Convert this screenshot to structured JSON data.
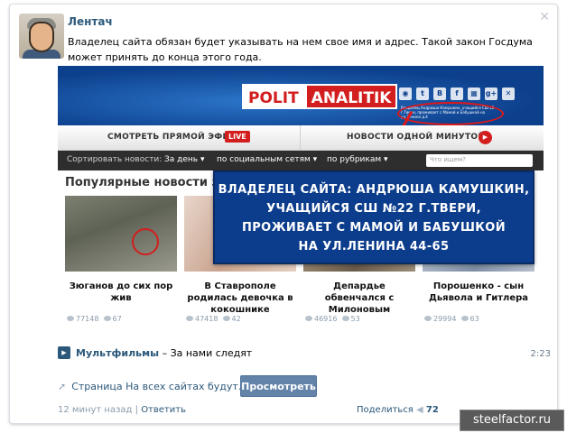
{
  "post": {
    "author": "Лентач",
    "text": "Владелец сайта обязан будет указывать на нем свое имя и адрес. Такой закон Госдума может принять до конца этого года."
  },
  "embed": {
    "logo_part1": "POLIT",
    "logo_part2": "ANALITIK",
    "socials": [
      "◉",
      "t",
      "B",
      "f",
      "▦",
      "g+",
      "✕"
    ],
    "owner_small_text": "Владелец Андрюша Камушкин, учащийся СШ 22 г.Твери, проживает с Мамой и Бабушкой на ул.Ленина д.4",
    "bar": {
      "live_label": "СМОТРЕТЬ ПРЯМОЙ ЭФИР",
      "live_badge": "LIVE",
      "news_label": "НОВОСТИ ОДНОЙ МИНУТОЙ"
    },
    "nav": {
      "sort_label": "Сортировать новости:",
      "by_day": "За день ▾",
      "by_social": "по социальным сетям ▾",
      "by_rubric": "по рубрикам ▾",
      "search_placeholder": "Что ищем?"
    },
    "popular_title": "Популярные новости за ...",
    "cards": [
      {
        "caption": "Зюганов до сих пор жив",
        "views": "77148",
        "likes": "67"
      },
      {
        "caption": "В Ставрополе родилась девочка в кокошнике",
        "views": "47418",
        "likes": "42"
      },
      {
        "caption": "Депардье обвенчался с Милоновым",
        "views": "46916",
        "likes": "53"
      },
      {
        "caption": "Порошенко - сын Дьявола и Гитлера",
        "views": "29994",
        "likes": "63"
      }
    ],
    "overlay_lines": [
      "ВЛАДЕЛЕЦ САЙТА: АНДРЮША КАМУШКИН,",
      "УЧАЩИЙСЯ СШ №22 Г.ТВЕРИ,",
      "ПРОЖИВАЕТ С МАМОЙ И БАБУШКОЙ",
      "НА УЛ.ЛЕНИНА 44-65"
    ]
  },
  "video": {
    "channel": "Мультфильмы",
    "title": "– За нами следят",
    "duration": "2:23"
  },
  "attachment": {
    "link_text": "Страница На всех сайтах будут...",
    "button_label": "Просмотреть"
  },
  "footer": {
    "time": "12 минут назад",
    "separator": "|",
    "reply": "Ответить",
    "share": "Поделиться",
    "like_count": "72"
  },
  "watermark": "steelfactor.ru",
  "close_glyph": "✕"
}
